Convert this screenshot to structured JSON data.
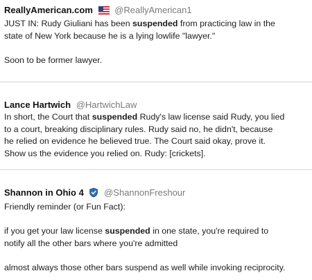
{
  "tweets": [
    {
      "name": "ReallyAmerican.com",
      "handle": "@ReallyAmerican1",
      "icon": "us-flag-icon",
      "lines": [
        [
          "JUST IN: Rudy Giuliani has been ",
          "suspended",
          " from practicing law in the"
        ],
        [
          "state of New York because he is a lying lowlife \"lawyer.\""
        ],
        [],
        [
          "Soon to be former lawyer."
        ]
      ]
    },
    {
      "name": "Lance Hartwich",
      "handle": "@HartwichLaw",
      "lines": [
        [
          "In short, the Court that ",
          "suspended",
          " Rudy's law license said Rudy, you lied"
        ],
        [
          "to a court, breaking disciplinary rules.  Rudy said no, he didn't, because"
        ],
        [
          "he relied on evidence he believed true.  The Court said okay, prove it."
        ],
        [
          "Show us the evidence you relied on.  Rudy:  [crickets]."
        ]
      ]
    },
    {
      "name": "Shannon in Ohio 4",
      "handle": "@ShannonFreshour",
      "icon": "shield-badge-icon",
      "lines": [
        [
          "Friendly reminder (or Fun Fact):"
        ],
        [],
        [
          "if you get your law license ",
          "suspended",
          " in one state, you're required to"
        ],
        [
          "notify all the other bars where you're admitted"
        ],
        [],
        [
          "almost always those other bars suspend as well while invoking reciprocity."
        ]
      ]
    }
  ]
}
